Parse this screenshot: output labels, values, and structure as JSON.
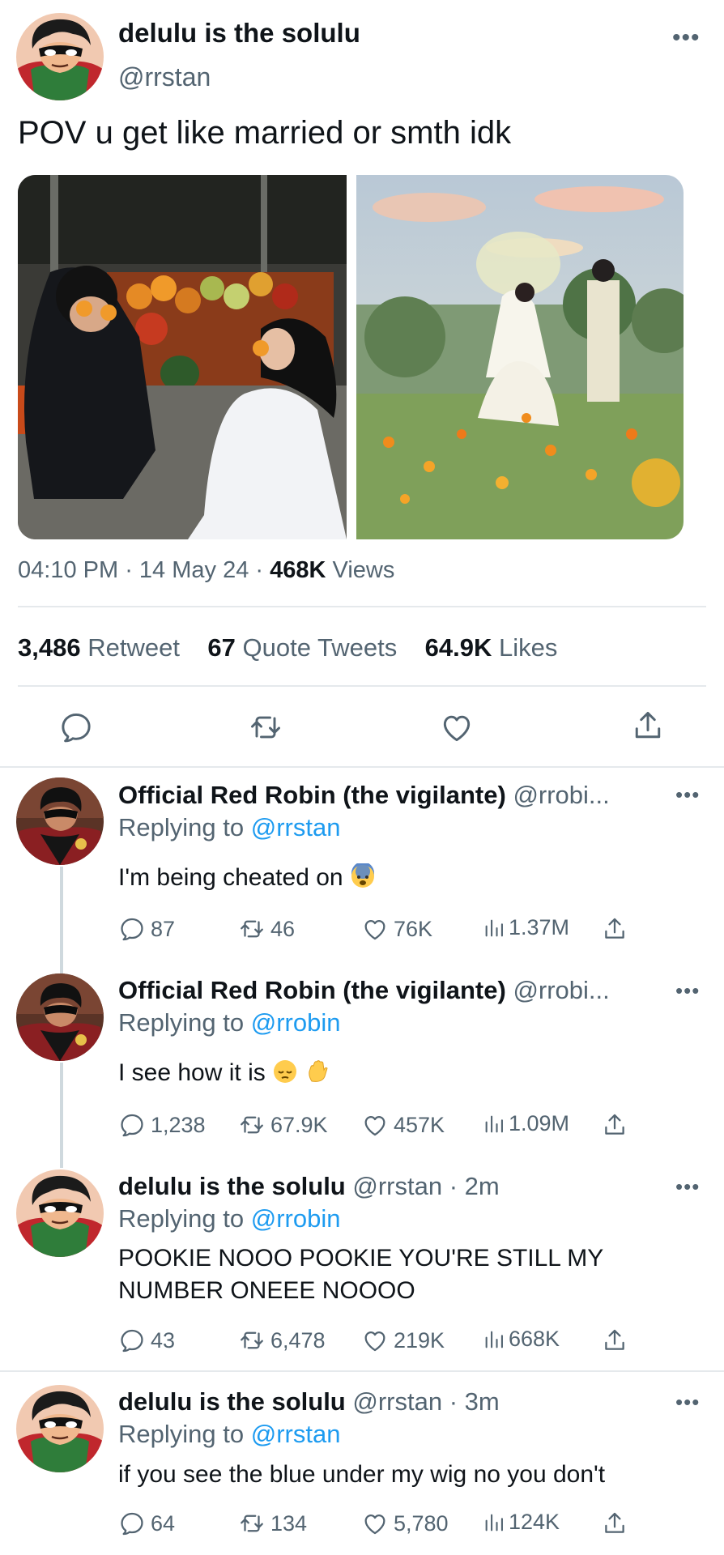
{
  "main_tweet": {
    "name": "delulu is the solulu",
    "handle": "@rrstan",
    "more": "•••",
    "text": "POV u get like married or smth idk",
    "time": "04:10 PM",
    "date": "14 May 24",
    "views_count": "468K",
    "views_label": "Views",
    "retweets_count": "3,486",
    "retweets_label": "Retweet",
    "quotes_count": "67",
    "quotes_label": "Quote Tweets",
    "likes_count": "64.9K",
    "likes_label": "Likes",
    "action_icons": [
      "reply-icon",
      "retweet-icon",
      "like-icon",
      "share-icon"
    ]
  },
  "replies": [
    {
      "name": "Official Red Robin (the vigilante)",
      "handle": "@rrobi...",
      "more": "•••",
      "replying_prefix": "Replying to",
      "replying_to": "@rrstan",
      "text": "I'm being cheated on",
      "emojis": [
        "fearful-face"
      ],
      "replies": "87",
      "retweets": "46",
      "likes": "76K",
      "views": "1.37M"
    },
    {
      "name": "Official Red Robin (the vigilante)",
      "handle": "@rrobi...",
      "more": "•••",
      "replying_prefix": "Replying to",
      "replying_to": "@rrobin",
      "text": "I see how it is",
      "emojis": [
        "pensive-face",
        "raised-hand"
      ],
      "replies": "1,238",
      "retweets": "67.9K",
      "likes": "457K",
      "views": "1.09M"
    },
    {
      "name": "delulu is the solulu",
      "handle": "@rrstan · 2m",
      "more": "•••",
      "replying_prefix": "Replying to",
      "replying_to": "@rrobin",
      "text_line1": "POOKIE NOOO POOKIE YOU'RE STILL MY",
      "text_line2": "NUMBER ONEEE NOOOO",
      "replies": "43",
      "retweets": "6,478",
      "likes": "219K",
      "views": "668K"
    },
    {
      "name": "delulu is the solulu",
      "handle": "@rrstan · 3m",
      "more": "•••",
      "replying_prefix": "Replying to",
      "replying_to": "@rrstan",
      "text": "if you see the blue under my wig no you don't",
      "replies": "64",
      "retweets": "134",
      "likes": "5,780",
      "views": "124K"
    }
  ],
  "colors": {
    "link": "#1d9bf0",
    "secondary_text": "#536471",
    "primary_text": "#0f1419",
    "divider": "#e5e9ec"
  }
}
